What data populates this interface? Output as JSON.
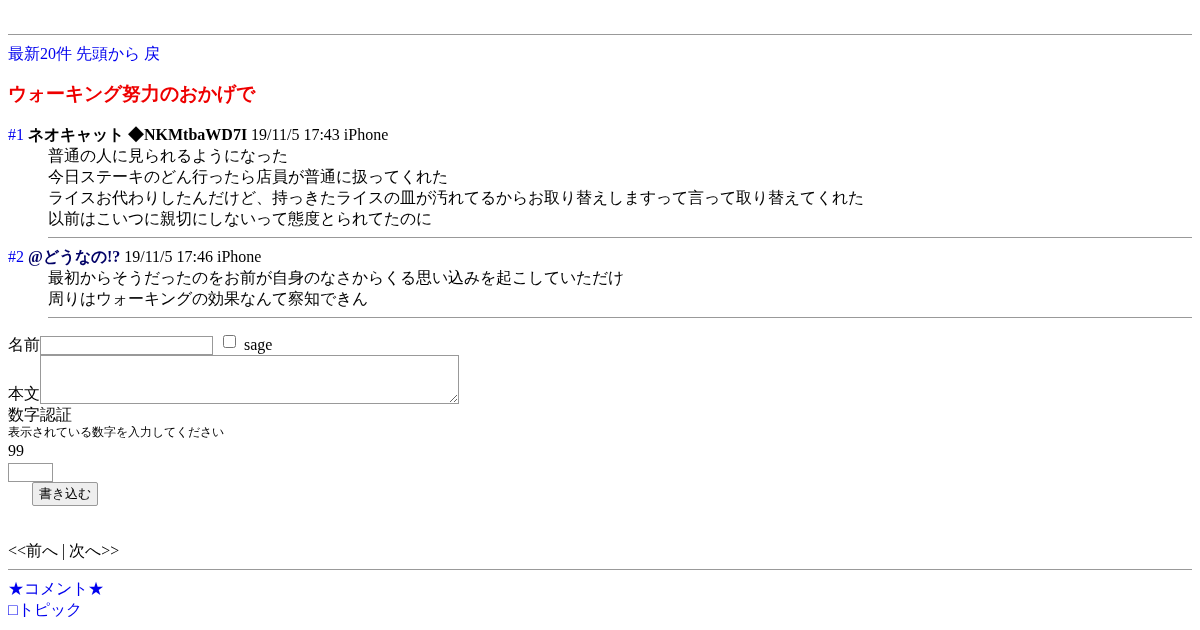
{
  "nav_links": [
    "最新20件",
    "先頭から",
    "戻"
  ],
  "thread_title": "ウォーキング努力のおかげで",
  "posts": [
    {
      "number": "#1",
      "name": "ネオキャット ◆NKMtbaWD7I",
      "kind": "plain",
      "meta": "19/11/5 17:43 iPhone",
      "lines": [
        "普通の人に見られるようになった",
        "今日ステーキのどん行ったら店員が普通に扱ってくれた",
        "ライスお代わりしたんだけど、持っきたライスの皿が汚れてるからお取り替えしますって言って取り替えてくれた",
        "以前はこいつに親切にしないって態度とられてたのに"
      ]
    },
    {
      "number": "#2",
      "name": "@どうなの!?",
      "kind": "mail",
      "meta": "19/11/5 17:46 iPhone",
      "lines": [
        "最初からそうだったのをお前が自身のなさからくる思い込みを起こしていただけ",
        "周りはウォーキングの効果なんて察知できん"
      ]
    }
  ],
  "form": {
    "name_label": "名前",
    "sage_label": "sage",
    "sage_checked": false,
    "body_label": "本文",
    "captcha_label": "数字認証",
    "captcha_hint": "表示されている数字を入力してください",
    "captcha_number": "99",
    "submit": "書き込む"
  },
  "pager": {
    "prev": "<<前へ",
    "separator": "|",
    "next": "次へ>>"
  },
  "footer_links": [
    "★コメント★",
    "□トピック"
  ]
}
